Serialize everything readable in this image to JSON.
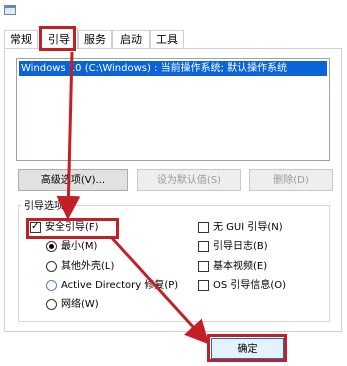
{
  "tabs": [
    {
      "label": "常规",
      "selected": false
    },
    {
      "label": "引导",
      "selected": true
    },
    {
      "label": "服务",
      "selected": false
    },
    {
      "label": "启动",
      "selected": false
    },
    {
      "label": "工具",
      "selected": false
    }
  ],
  "os_list": {
    "entries": [
      "Windows 10 (C:\\Windows) : 当前操作系统; 默认操作系统"
    ]
  },
  "buttons": {
    "advanced": "高级选项(V)...",
    "set_default": "设为默认值(S)",
    "delete": "删除(D)"
  },
  "boot_options": {
    "group_label": "引导选项",
    "safe_boot": {
      "label": "安全引导(F)",
      "checked": true
    },
    "minimal": {
      "label": "最小(M)",
      "selected": true
    },
    "alternate_shell": {
      "label": "其他外壳(L)",
      "selected": false
    },
    "active_directory": {
      "label": "Active Directory 修复(P)",
      "selected": false
    },
    "network": {
      "label": "网络(W)",
      "selected": false
    },
    "no_gui": {
      "label": "无 GUI 引导(N)",
      "checked": false
    },
    "boot_log": {
      "label": "引导日志(B)",
      "checked": false
    },
    "base_video": {
      "label": "基本视频(E)",
      "checked": false
    },
    "os_boot_info": {
      "label": "OS 引导信息(O)",
      "checked": false
    }
  },
  "ok_button": {
    "label": "确定"
  },
  "annotation_color": "#c41e26",
  "selection_color": "#0a64d8"
}
